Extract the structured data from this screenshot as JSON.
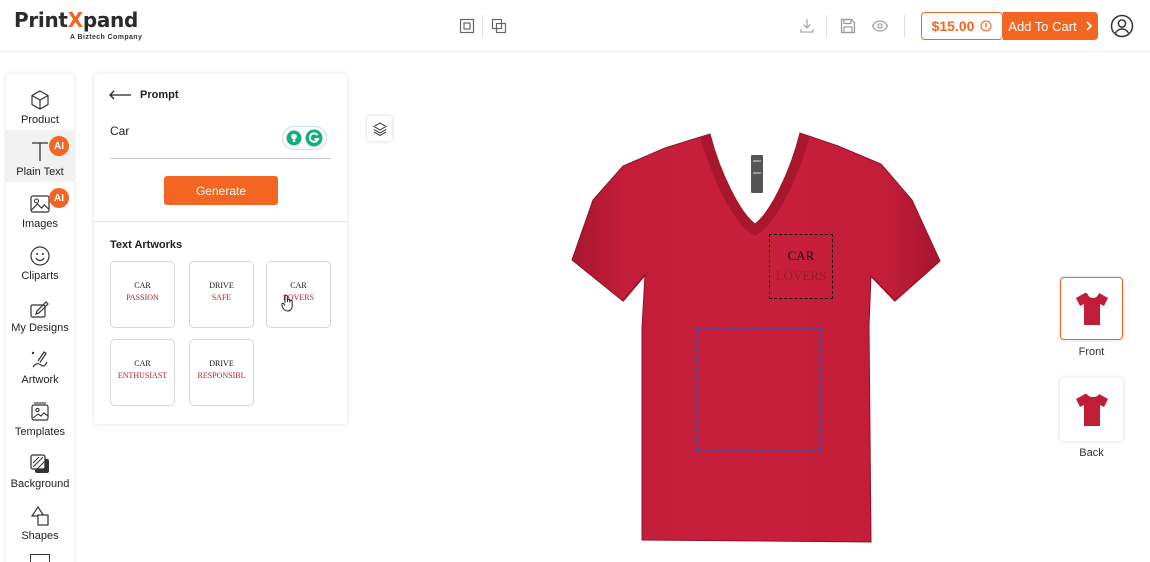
{
  "brand": {
    "name_part1": "Print",
    "name_x": "X",
    "name_part2": "pand",
    "tagline": "A Biztech Company",
    "accent": "#f26522"
  },
  "toolbar": {
    "center_icons": [
      "fit-screen-icon",
      "duplicate-icon"
    ],
    "right_icons": [
      "download-icon",
      "save-icon",
      "preview-icon"
    ],
    "price": "$15.00",
    "price_info_icon": "info-icon",
    "add_to_cart": "Add To Cart",
    "cart_chevron": "›",
    "user_icon": "user-icon"
  },
  "sidebar": {
    "items": [
      {
        "label": "Product",
        "icon": "cube-icon"
      },
      {
        "label": "Plain Text",
        "icon": "text-icon",
        "badge": "AI"
      },
      {
        "label": "Images",
        "icon": "image-icon",
        "badge": "AI"
      },
      {
        "label": "Cliparts",
        "icon": "smiley-icon"
      },
      {
        "label": "My Designs",
        "icon": "my-designs-icon"
      },
      {
        "label": "Artwork",
        "icon": "artwork-icon"
      },
      {
        "label": "Templates",
        "icon": "templates-icon"
      },
      {
        "label": "Background",
        "icon": "background-icon"
      },
      {
        "label": "Shapes",
        "icon": "shapes-icon"
      }
    ]
  },
  "panel": {
    "back_label": "Prompt",
    "prompt_value": "Car",
    "generate_label": "Generate",
    "artworks_title": "Text Artworks",
    "artworks": [
      {
        "line1": "CAR",
        "line2": "PASSION"
      },
      {
        "line1": "DRIVE",
        "line2": "SAFE"
      },
      {
        "line1": "CAR",
        "line2": "LOVERS"
      },
      {
        "line1": "CAR",
        "line2": "ENTHUSIAST"
      },
      {
        "line1": "DRIVE",
        "line2": "RESPONSIBL"
      }
    ]
  },
  "canvas": {
    "shirt_color": "#c11d38",
    "placed_text": {
      "line1": "CAR",
      "line2": "LOVERS"
    }
  },
  "views": [
    {
      "label": "Front",
      "selected": true
    },
    {
      "label": "Back",
      "selected": false
    }
  ]
}
